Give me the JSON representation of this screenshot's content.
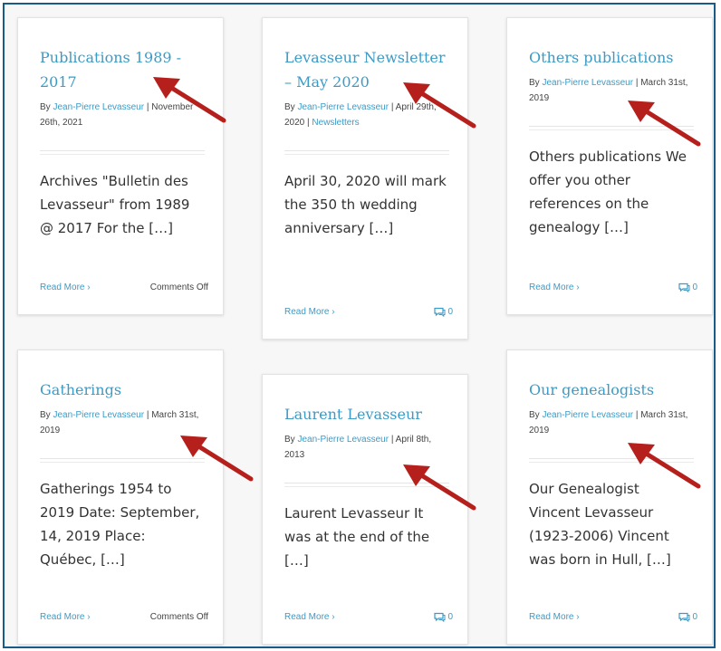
{
  "cards": [
    {
      "title": "Publications 1989 - 2017",
      "by": "By ",
      "author": "Jean-Pierre Levasseur",
      "sep": " | ",
      "date": "November 26th, 2021",
      "excerpt": "Archives \"Bulletin des Levasseur\" from 1989 @ 2017 For the […]",
      "read_more": "Read More ›",
      "comments": "Comments Off"
    },
    {
      "title": "Levasseur Newsletter – May 2020",
      "by": "By ",
      "author": "Jean-Pierre Levasseur",
      "sep": " | ",
      "date": "April 29th, 2020",
      "sep2": " | ",
      "category": "Newsletters",
      "excerpt": "April 30, 2020 will mark the 350 th wedding anniversary […]",
      "read_more": "Read More ›",
      "comment_count": "0"
    },
    {
      "title": "Others publications",
      "by": "By ",
      "author": "Jean-Pierre Levasseur",
      "sep": " | ",
      "date": "March 31st, 2019",
      "excerpt": "Others publications We offer you other references on the genealogy […]",
      "read_more": "Read More ›",
      "comment_count": "0"
    },
    {
      "title": "Gatherings",
      "by": "By ",
      "author": "Jean-Pierre Levasseur",
      "sep": " | ",
      "date": "March 31st, 2019",
      "excerpt": "Gatherings 1954 to 2019 Date: September, 14,  2019 Place: Québec, […]",
      "read_more": "Read More ›",
      "comments": "Comments Off"
    },
    {
      "title": "Laurent Levasseur",
      "by": "By ",
      "author": "Jean-Pierre Levasseur",
      "sep": " | ",
      "date": "April 8th, 2013",
      "excerpt": "Laurent Levasseur It was at the end of the […]",
      "read_more": "Read More ›",
      "comment_count": "0"
    },
    {
      "title": "Our genealogists",
      "by": "By ",
      "author": "Jean-Pierre Levasseur",
      "sep": " | ",
      "date": "March 31st, 2019",
      "excerpt": "Our Genealogist Vincent Levasseur (1923-2006) Vincent was born in Hull, […]",
      "read_more": "Read More ›",
      "comment_count": "0"
    }
  ],
  "colors": {
    "link": "#3b9bc6",
    "arrow": "#b5201c",
    "frame": "#1a5a86"
  },
  "icons": {
    "comment": "speech-bubble-icon",
    "annotation": "red-arrow-icon"
  }
}
